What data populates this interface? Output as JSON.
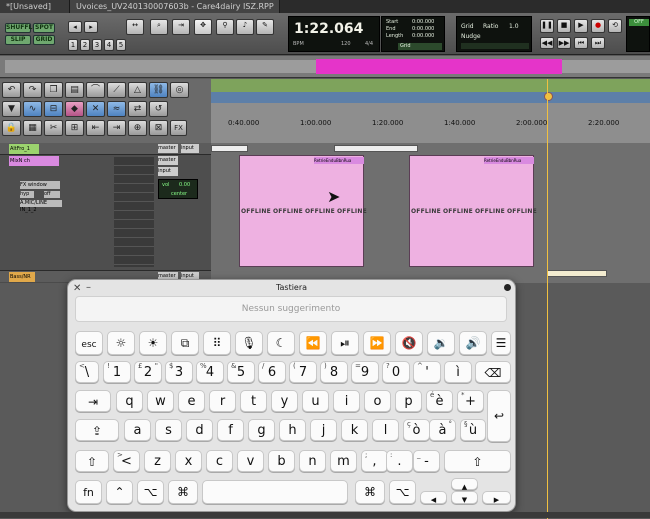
{
  "window": {
    "tabs": [
      "*[Unsaved]",
      "Uvoices_UV240130007603b - Care4dairy ISZ.RPP"
    ]
  },
  "toolbar": {
    "mode_buttons": [
      "SHUFFLE",
      "SPOT",
      "SLIP",
      "GRID"
    ],
    "grid_numbers": [
      "1",
      "2",
      "3",
      "4",
      "5"
    ],
    "counter": "1:22.064",
    "bpm_label": "BPM",
    "bpm_value": "120",
    "meter": "4/4",
    "start_label": "Start",
    "end_label": "End",
    "length_label": "Length",
    "start_value": "0:00.000",
    "end_value": "0:00.000",
    "length_value": "0:00.000",
    "grid_label": "Grid",
    "nudge_label": "Nudge",
    "ratio_label": "Ratio",
    "ratio_value": "1.0",
    "off_label": "OFF"
  },
  "rulers": {
    "times": [
      "0:40.000",
      "1:00.000",
      "1:20.000",
      "1:40.000",
      "2:00.000",
      "2:20.000"
    ]
  },
  "left_panel": {
    "fx_label": "FX"
  },
  "tracks": [
    {
      "name": "AltFro_1",
      "output": "master",
      "input": "input"
    },
    {
      "name": "MixN ch",
      "output": "master",
      "input": "input",
      "fx": "FX window",
      "mode": "hyp",
      "send": "off",
      "input_detail": "A.MIC/LINE IN_1_2",
      "vol_label": "vol",
      "vol_value": "0.00",
      "pan_value": "center"
    },
    {
      "name": "Bass/NR",
      "output": "master",
      "input": "input"
    }
  ],
  "clips": {
    "title": "RetrieEnduBbnRua",
    "offline_label": "OFFLINE"
  },
  "keyboard": {
    "title": "Tastiera",
    "suggestion_placeholder": "Nessun suggerimento",
    "esc": "esc",
    "fn": "fn",
    "rows": {
      "num": [
        {
          "m": "\\",
          "a": "<"
        },
        {
          "m": "1",
          "a": "!"
        },
        {
          "m": "2",
          "a": "£",
          "b": "\""
        },
        {
          "m": "3",
          "a": "$"
        },
        {
          "m": "4",
          "a": "%"
        },
        {
          "m": "5",
          "a": "&"
        },
        {
          "m": "6",
          "a": "/"
        },
        {
          "m": "7",
          "a": "("
        },
        {
          "m": "8",
          "a": ")"
        },
        {
          "m": "9",
          "a": "="
        },
        {
          "m": "0",
          "a": "?"
        },
        {
          "m": "'",
          "a": "^"
        },
        {
          "m": "ì",
          "a": ""
        }
      ],
      "top": [
        "q",
        "w",
        "e",
        "r",
        "t",
        "y",
        "u",
        "i",
        "o",
        "p"
      ],
      "top_extra": [
        {
          "m": "è",
          "a": "é"
        },
        {
          "m": "+",
          "a": "*"
        }
      ],
      "home": [
        "a",
        "s",
        "d",
        "f",
        "g",
        "h",
        "j",
        "k",
        "l"
      ],
      "home_extra": [
        {
          "m": "ò",
          "a": "ç"
        },
        {
          "m": "à",
          "a": "°"
        },
        {
          "m": "ù",
          "a": "§"
        }
      ],
      "bottom": [
        "z",
        "x",
        "c",
        "v",
        "b",
        "n",
        "m"
      ],
      "bottom_extra": [
        {
          "m": "<",
          "a": ">"
        },
        {
          "m": ",",
          "a": ";"
        },
        {
          "m": ".",
          "a": ":"
        },
        {
          "m": "-",
          "a": "_"
        }
      ]
    }
  },
  "colors": {
    "clip_fill": "#eeb1e1",
    "track_name": "#d98ae0",
    "playhead": "#f0c040",
    "loop_bar": "#e534c9"
  }
}
